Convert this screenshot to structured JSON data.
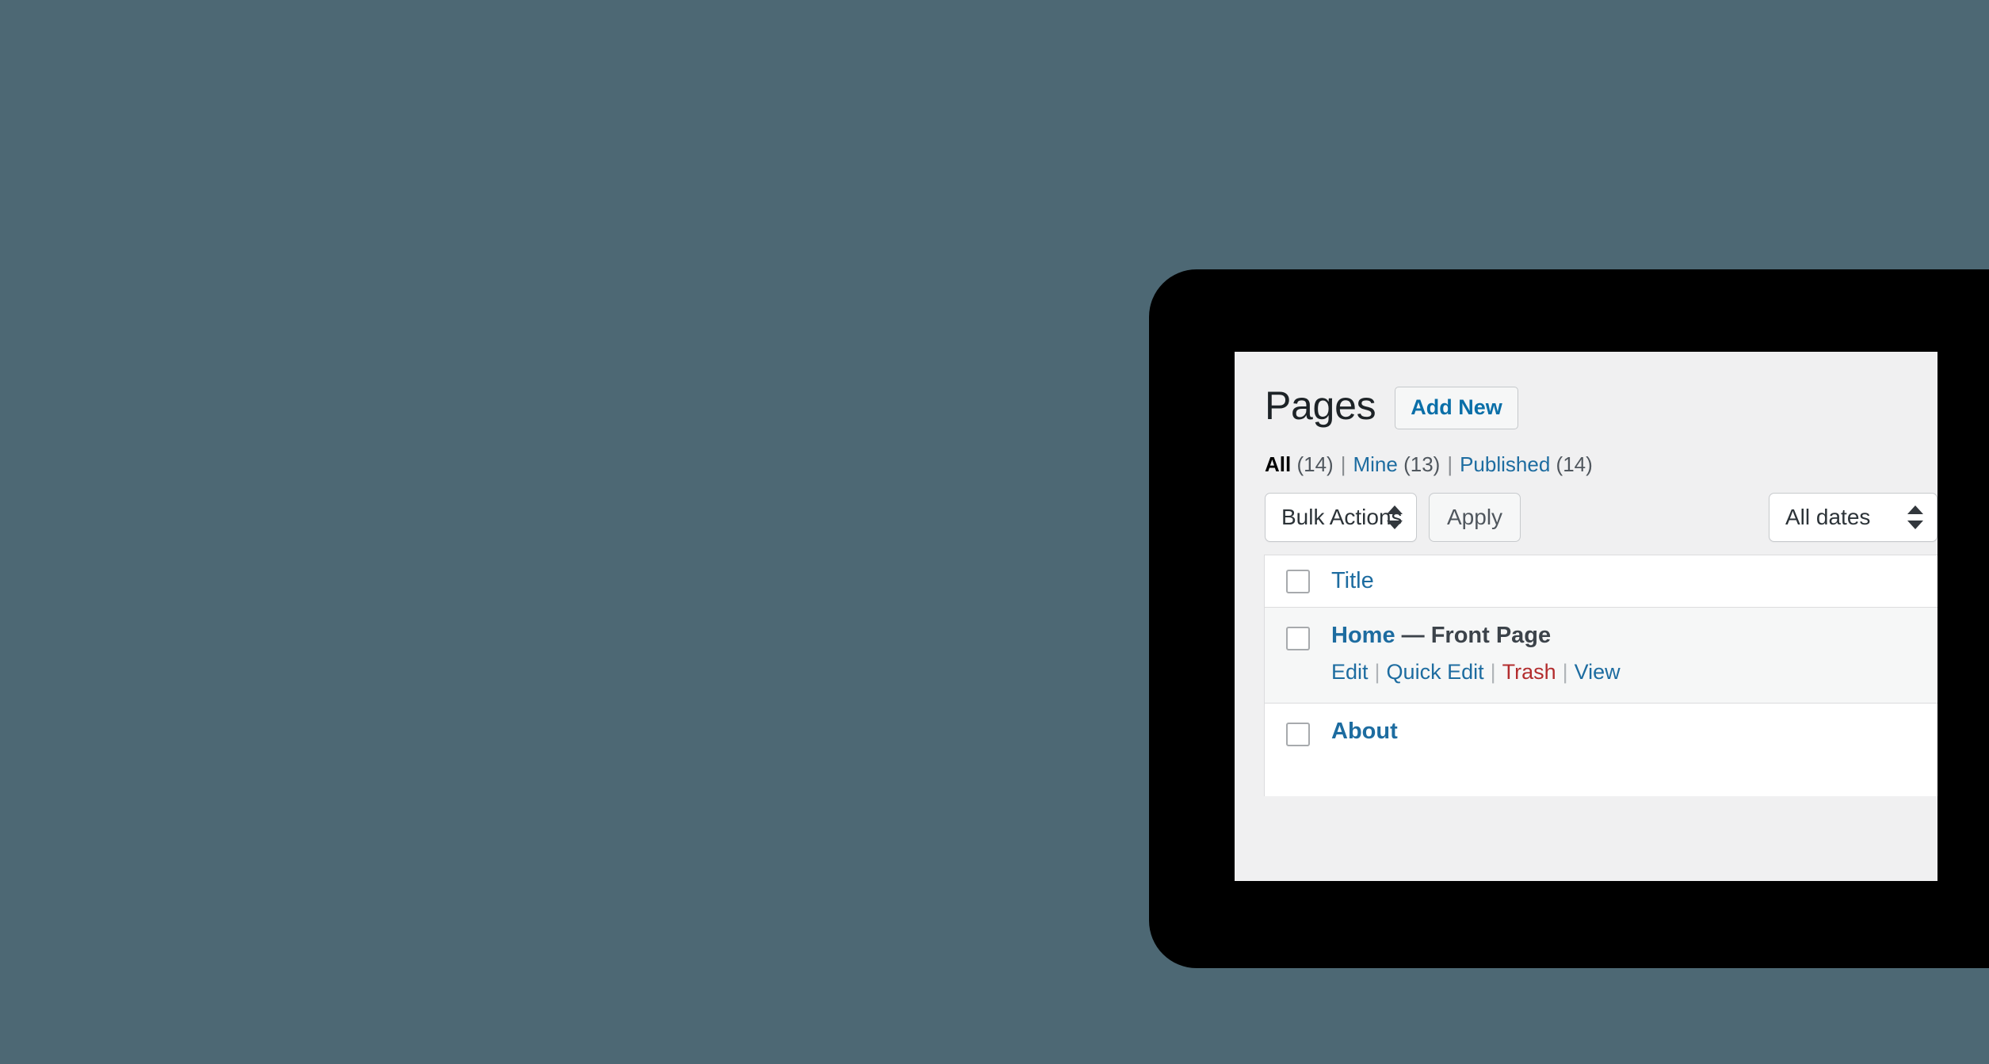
{
  "background_color": "#4d6874",
  "device": {
    "frame_color": "#000000",
    "screen_bg": "#f0f0f1"
  },
  "header": {
    "title": "Pages",
    "add_new_label": "Add New"
  },
  "filters": {
    "items": [
      {
        "label": "All",
        "count": "(14)",
        "current": true
      },
      {
        "label": "Mine",
        "count": "(13)",
        "current": false
      },
      {
        "label": "Published",
        "count": "(14)",
        "current": false
      }
    ],
    "separator": "|"
  },
  "tablenav": {
    "bulk_actions_value": "Bulk Actions",
    "apply_label": "Apply",
    "date_filter_value": "All dates"
  },
  "table": {
    "columns": [
      {
        "label": "Title",
        "key": "title"
      }
    ],
    "rows": [
      {
        "title": "Home",
        "badge": "— Front Page",
        "actions": [
          {
            "label": "Edit",
            "kind": "edit"
          },
          {
            "label": "Quick Edit",
            "kind": "quick-edit"
          },
          {
            "label": "Trash",
            "kind": "trash"
          },
          {
            "label": "View",
            "kind": "view"
          }
        ]
      },
      {
        "title": "About",
        "badge": "",
        "actions": []
      }
    ]
  },
  "colors": {
    "link_blue": "#1d6ca0",
    "trash_red": "#b32d2e",
    "heading": "#1d2327",
    "muted": "#50575e",
    "row_alt_bg": "#f6f7f7"
  }
}
